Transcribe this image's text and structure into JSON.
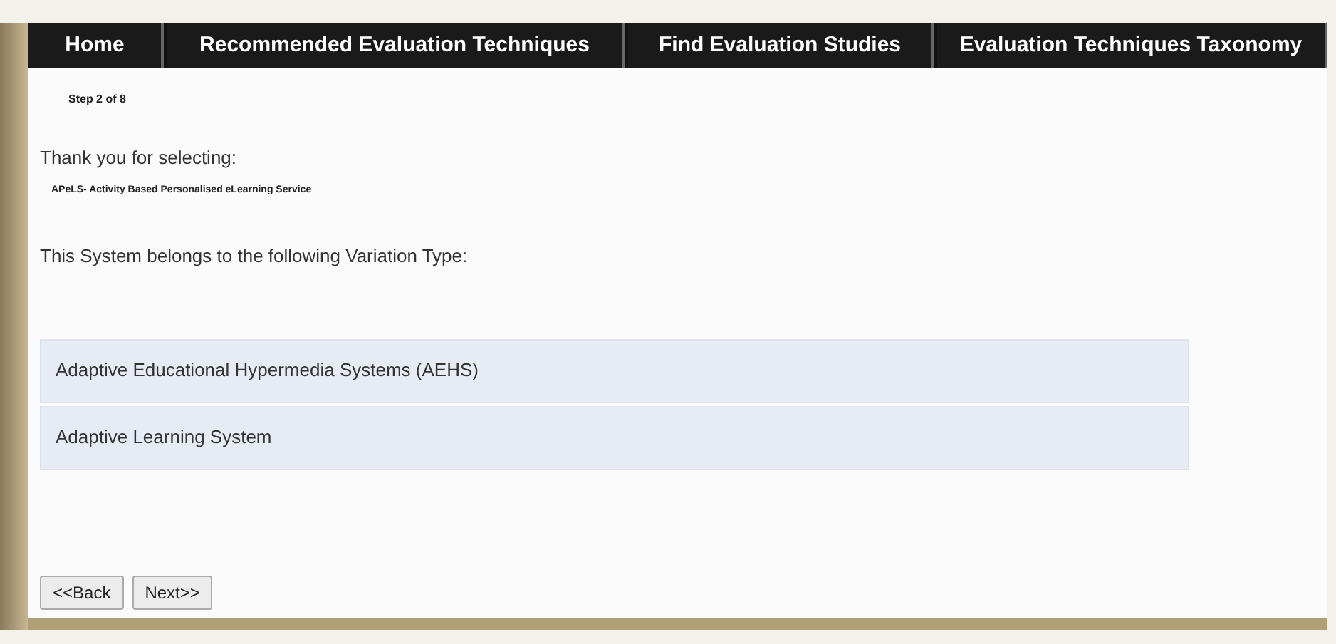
{
  "nav": [
    {
      "label": "Home"
    },
    {
      "label": "Recommended Evaluation Techniques"
    },
    {
      "label": "Find Evaluation Studies"
    },
    {
      "label": "Evaluation Techniques Taxonomy"
    }
  ],
  "step": "Step 2 of 8",
  "intro": "Thank you for selecting:",
  "system": "APeLS- Activity Based Personalised eLearning Service",
  "variation_heading": "This System belongs to the following Variation Type:",
  "variation_types": [
    {
      "label": "Adaptive Educational Hypermedia Systems (AEHS)"
    },
    {
      "label": "Adaptive Learning System"
    }
  ],
  "buttons": [
    {
      "label": "<<Back"
    },
    {
      "label": "Next>>"
    }
  ]
}
